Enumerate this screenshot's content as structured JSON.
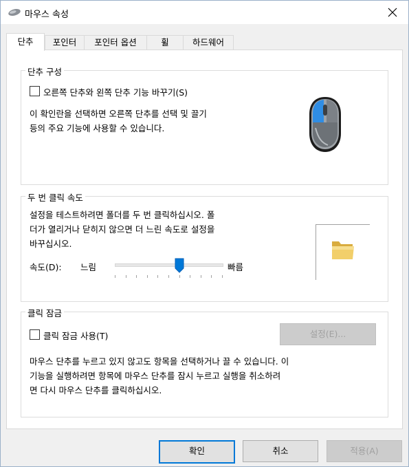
{
  "window": {
    "title": "마우스 속성",
    "title_icon": "mouse-icon",
    "close_icon": "close-icon"
  },
  "tabs": [
    {
      "label": "단추",
      "active": true
    },
    {
      "label": "포인터",
      "active": false
    },
    {
      "label": "포인터 옵션",
      "active": false
    },
    {
      "label": "휠",
      "active": false
    },
    {
      "label": "하드웨어",
      "active": false
    }
  ],
  "button_config": {
    "title": "단추 구성",
    "checkbox_label": "오른쪽 단추와 왼쪽 단추 기능 바꾸기(S)",
    "checked": false,
    "description_line1": "이 확인란을 선택하면 오른쪽 단추를 선택 및 끌기",
    "description_line2": "등의 주요 기능에 사용할 수 있습니다.",
    "illustration": "mouse-illustration",
    "highlight_color": "#2f8de4"
  },
  "double_click": {
    "title": "두 번 클릭 속도",
    "description_line1": "설정을 테스트하려면 폴더를 두 번 클릭하십시오. 폴",
    "description_line2": "더가 열리거나 닫히지 않으면 더 느린 속도로 설정을",
    "description_line3": "바꾸십시오.",
    "speed_label": "속도(D):",
    "slow_label": "느림",
    "fast_label": "빠름",
    "speed_value": 0.6,
    "test_icon": "folder-icon"
  },
  "click_lock": {
    "title": "클릭 잠금",
    "checkbox_label": "클릭 잠금 사용(T)",
    "checked": false,
    "settings_button": "설정(E)...",
    "description_line1": "마우스 단추를 누르고 있지 않고도 항목을 선택하거나 끌 수 있습니다. 이",
    "description_line2": "기능을 실행하려면 항목에 마우스 단추를 잠시 누르고 실행을 취소하려",
    "description_line3": "면 다시 마우스 단추를 클릭하십시오."
  },
  "footer": {
    "ok": "확인",
    "cancel": "취소",
    "apply": "적용(A)"
  },
  "colors": {
    "accent": "#0078d7",
    "dialog_bg": "#f0f0f0",
    "disabled_text": "#a0a0a0"
  }
}
